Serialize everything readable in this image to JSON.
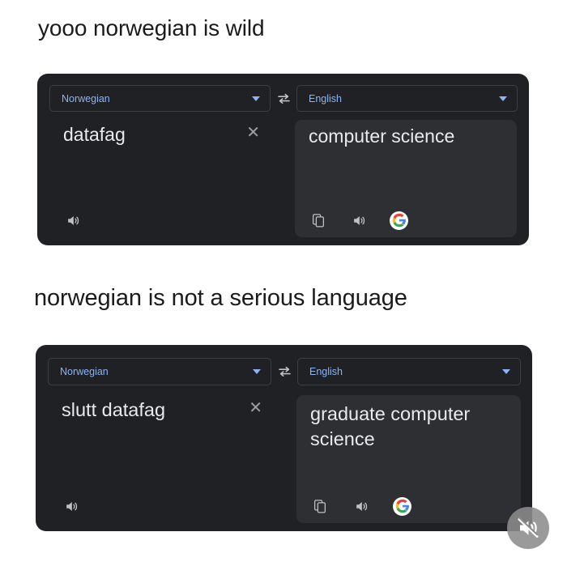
{
  "page": {
    "background_color": "#ffffff",
    "caption_color": "#1b1b1b"
  },
  "captions": {
    "first": "yooo norwegian is wild",
    "second": "norwegian is not a serious language"
  },
  "theme": {
    "card_background": "#202124",
    "result_background": "#2e2f32",
    "language_accent": "#8ab4f8",
    "text_color": "#e8eaed",
    "icon_color": "#9aa0a6",
    "border_color": "#3c4043"
  },
  "cards": [
    {
      "source_language": "Norwegian",
      "target_language": "English",
      "source_text": "datafag",
      "result_text": "computer science",
      "swap_icon": "swap-horizontal-icon",
      "source_caret_icon": "chevron-down-icon",
      "target_caret_icon": "chevron-down-icon",
      "clear_icon": "close-icon",
      "clear_glyph": "✕",
      "source_listen_icon": "speaker-icon",
      "copy_icon": "copy-icon",
      "result_listen_icon": "speaker-icon",
      "google_icon": "google-g-icon"
    },
    {
      "source_language": "Norwegian",
      "target_language": "English",
      "source_text": "slutt datafag",
      "result_text": "graduate computer science",
      "swap_icon": "swap-horizontal-icon",
      "source_caret_icon": "chevron-down-icon",
      "target_caret_icon": "chevron-down-icon",
      "clear_icon": "close-icon",
      "clear_glyph": "✕",
      "source_listen_icon": "speaker-icon",
      "copy_icon": "copy-icon",
      "result_listen_icon": "speaker-icon",
      "google_icon": "google-g-icon"
    }
  ],
  "overlay": {
    "mute_icon": "speaker-muted-icon",
    "background_color": "rgba(140,140,140,0.88)"
  }
}
